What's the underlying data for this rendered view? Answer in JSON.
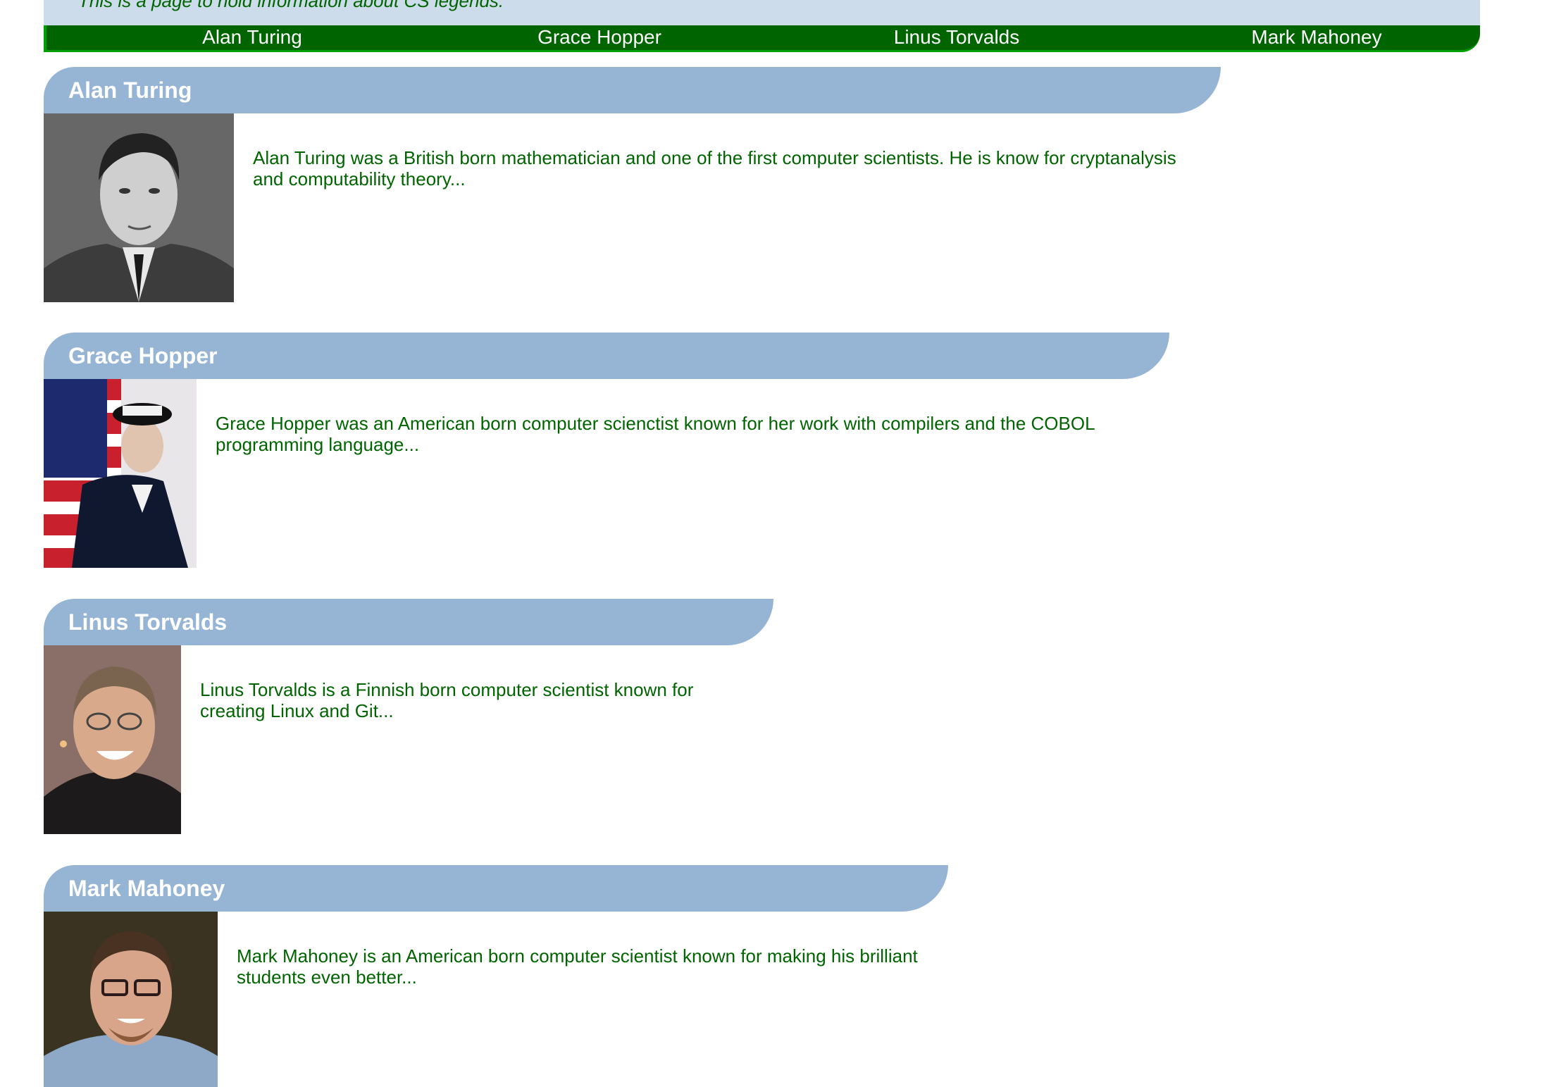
{
  "header": {
    "tagline": "This is a page to hold information about CS legends."
  },
  "nav": {
    "links": [
      {
        "label": "Alan Turing"
      },
      {
        "label": "Grace Hopper"
      },
      {
        "label": "Linus Torvalds"
      },
      {
        "label": "Mark Mahoney"
      }
    ]
  },
  "legends": [
    {
      "name": "Alan Turing",
      "bio": "Alan Turing was a British born mathematician and one of the first computer scientists. He is know for cryptanalysis and computability theory...",
      "photo_icon": "portrait-photo"
    },
    {
      "name": "Grace Hopper",
      "bio": "Grace Hopper was an American born computer scienctist known for her work with compilers and the COBOL programming language...",
      "photo_icon": "portrait-photo"
    },
    {
      "name": "Linus Torvalds",
      "bio": "Linus Torvalds is a Finnish born computer scientist known for creating Linux and Git...",
      "photo_icon": "portrait-photo"
    },
    {
      "name": "Mark Mahoney",
      "bio": "Mark Mahoney is an American born computer scientist known for making his brilliant students even better...",
      "photo_icon": "portrait-photo"
    }
  ],
  "colors": {
    "accent_green": "#006400",
    "header_blue": "#96b4d4",
    "banner_blue": "#cddcea"
  }
}
